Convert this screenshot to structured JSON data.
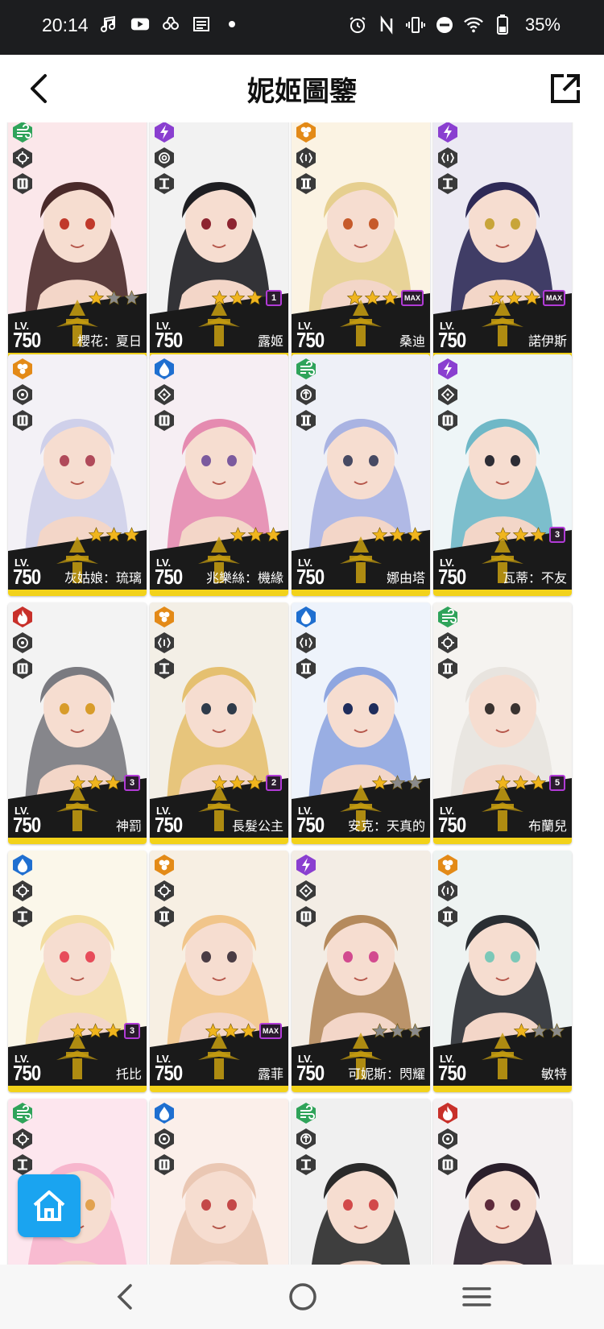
{
  "status_bar": {
    "time": "20:14",
    "battery_percent": "35%",
    "left_icons": [
      "music-note-icon",
      "youtube-icon",
      "game-controller-icon",
      "news-icon",
      "dot-icon"
    ],
    "right_icons": [
      "alarm-icon",
      "nfc-icon",
      "vibrate-icon",
      "do-not-disturb-icon",
      "wifi-icon",
      "battery-icon"
    ]
  },
  "header": {
    "title": "妮姬圖鑒",
    "back_icon": "chevron-left-icon",
    "share_icon": "open-external-icon"
  },
  "colors": {
    "accent": "#1aa4f0",
    "level_bar": "#f2d21a",
    "star": "#f0b51e",
    "star_empty": "#8a8a8a",
    "badge_border": "#b13bd6",
    "element": {
      "wind": "#2fa35a",
      "electric": "#8a3fd0",
      "iron": "#e38a17",
      "water": "#1f6fd0",
      "fire": "#c8302a"
    }
  },
  "cards": [
    {
      "name": "櫻花：夏日",
      "level": "750",
      "lv_label": "LV.",
      "element": "wind",
      "weapon": "crosshair",
      "burst": "III",
      "stars": 1,
      "badge": ""
    },
    {
      "name": "露姬",
      "level": "750",
      "lv_label": "LV.",
      "element": "electric",
      "weapon": "circle",
      "burst": "I",
      "stars": 3,
      "badge": "1"
    },
    {
      "name": "桑迪",
      "level": "750",
      "lv_label": "LV.",
      "element": "iron",
      "weapon": "bracket",
      "burst": "II",
      "stars": 3,
      "badge": "MAX"
    },
    {
      "name": "諾伊斯",
      "level": "750",
      "lv_label": "LV.",
      "element": "electric",
      "weapon": "bracket",
      "burst": "I",
      "stars": 3,
      "badge": "MAX"
    },
    {
      "name": "灰姑娘：琉璃",
      "level": "750",
      "lv_label": "LV.",
      "element": "iron",
      "weapon": "dot",
      "burst": "III",
      "stars": 3,
      "badge": ""
    },
    {
      "name": "兆樂絲：機緣",
      "level": "750",
      "lv_label": "LV.",
      "element": "water",
      "weapon": "diamond",
      "burst": "III",
      "stars": 3,
      "badge": ""
    },
    {
      "name": "娜由塔",
      "level": "750",
      "lv_label": "LV.",
      "element": "wind",
      "weapon": "arrow",
      "burst": "II",
      "stars": 3,
      "badge": ""
    },
    {
      "name": "瓦蒂：不友",
      "level": "750",
      "lv_label": "LV.",
      "element": "electric",
      "weapon": "diamond",
      "burst": "III",
      "stars": 3,
      "badge": "3"
    },
    {
      "name": "神罰",
      "level": "750",
      "lv_label": "LV.",
      "element": "fire",
      "weapon": "dot",
      "burst": "III",
      "stars": 3,
      "badge": "3"
    },
    {
      "name": "長髮公主",
      "level": "750",
      "lv_label": "LV.",
      "element": "iron",
      "weapon": "bracket",
      "burst": "I",
      "stars": 3,
      "badge": "2"
    },
    {
      "name": "安克：天真的",
      "level": "750",
      "lv_label": "LV.",
      "element": "water",
      "weapon": "bracket",
      "burst": "II",
      "stars": 1,
      "badge": ""
    },
    {
      "name": "布蘭兒",
      "level": "750",
      "lv_label": "LV.",
      "element": "wind",
      "weapon": "crosshair",
      "burst": "II",
      "stars": 3,
      "badge": "5"
    },
    {
      "name": "托比",
      "level": "750",
      "lv_label": "LV.",
      "element": "water",
      "weapon": "crosshair",
      "burst": "I",
      "stars": 3,
      "badge": "3"
    },
    {
      "name": "露菲",
      "level": "750",
      "lv_label": "LV.",
      "element": "iron",
      "weapon": "crosshair",
      "burst": "II",
      "stars": 3,
      "badge": "MAX"
    },
    {
      "name": "可妮斯：閃耀",
      "level": "750",
      "lv_label": "LV.",
      "element": "electric",
      "weapon": "diamond",
      "burst": "III",
      "stars": 0,
      "badge": ""
    },
    {
      "name": "敏特",
      "level": "750",
      "lv_label": "LV.",
      "element": "iron",
      "weapon": "bracket",
      "burst": "II",
      "stars": 1,
      "badge": ""
    },
    {
      "name": "",
      "level": "",
      "lv_label": "",
      "element": "wind",
      "weapon": "crosshair",
      "burst": "I",
      "stars": -1,
      "badge": ""
    },
    {
      "name": "",
      "level": "",
      "lv_label": "",
      "element": "water",
      "weapon": "dot",
      "burst": "III",
      "stars": -1,
      "badge": ""
    },
    {
      "name": "",
      "level": "",
      "lv_label": "",
      "element": "wind",
      "weapon": "arrow",
      "burst": "I",
      "stars": -1,
      "badge": ""
    },
    {
      "name": "",
      "level": "",
      "lv_label": "",
      "element": "fire",
      "weapon": "dot",
      "burst": "III",
      "stars": -1,
      "badge": ""
    }
  ],
  "home_button": {
    "icon": "home-icon"
  },
  "nav_bar": {
    "icons": [
      "nav-back-icon",
      "nav-home-icon",
      "nav-recents-icon"
    ]
  }
}
